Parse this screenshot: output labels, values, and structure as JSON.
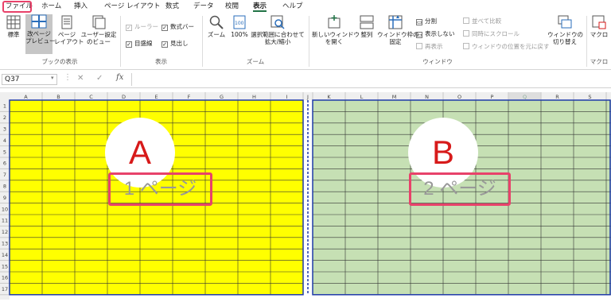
{
  "tabs": [
    "ファイル",
    "ホーム",
    "挿入",
    "ページ レイアウト",
    "数式",
    "データ",
    "校閲",
    "表示",
    "ヘルプ"
  ],
  "ribbon": {
    "views": {
      "normal": "標準",
      "pagebreak": "改ページ\nプレビュー",
      "pagelayout": "ページ\nレイアウト",
      "custom": "ユーザー設定\nのビュー",
      "group": "ブックの表示"
    },
    "show": {
      "ruler": "ルーラー",
      "formula_bar": "数式バー",
      "gridlines": "目盛線",
      "headings": "見出し",
      "group": "表示"
    },
    "zoom": {
      "zoom": "ズーム",
      "hundred": "100%",
      "fit": "選択範囲に合わせて\n拡大/縮小",
      "group": "ズーム"
    },
    "window": {
      "new": "新しいウィンドウ\nを開く",
      "arrange": "整列",
      "freeze": "ウィンドウ枠の\n固定",
      "split": "分割",
      "hide": "表示しない",
      "unhide": "再表示",
      "side": "並べて比較",
      "sync": "同時にスクロール",
      "reset": "ウィンドウの位置を元に戻す",
      "switch": "ウィンドウの\n切り替え",
      "group": "ウィンドウ"
    },
    "macro": {
      "label": "マクロ",
      "group": "マクロ"
    }
  },
  "formula_bar": {
    "cell_ref": "Q37",
    "fx": "fx"
  },
  "sheet": {
    "columns": [
      "A",
      "B",
      "C",
      "D",
      "E",
      "F",
      "G",
      "H",
      "I",
      "J",
      "K",
      "L",
      "M",
      "N",
      "O",
      "P",
      "Q",
      "R",
      "S"
    ],
    "rows": [
      "1",
      "2",
      "3",
      "4",
      "5",
      "6",
      "7",
      "8",
      "9",
      "10",
      "11",
      "12",
      "13",
      "14",
      "15",
      "16",
      "17"
    ],
    "page_a": {
      "letter": "A",
      "label": "1 ページ",
      "color": "#ffff00"
    },
    "page_b": {
      "letter": "B",
      "label": "2 ページ",
      "color": "#c6e0b4"
    }
  }
}
